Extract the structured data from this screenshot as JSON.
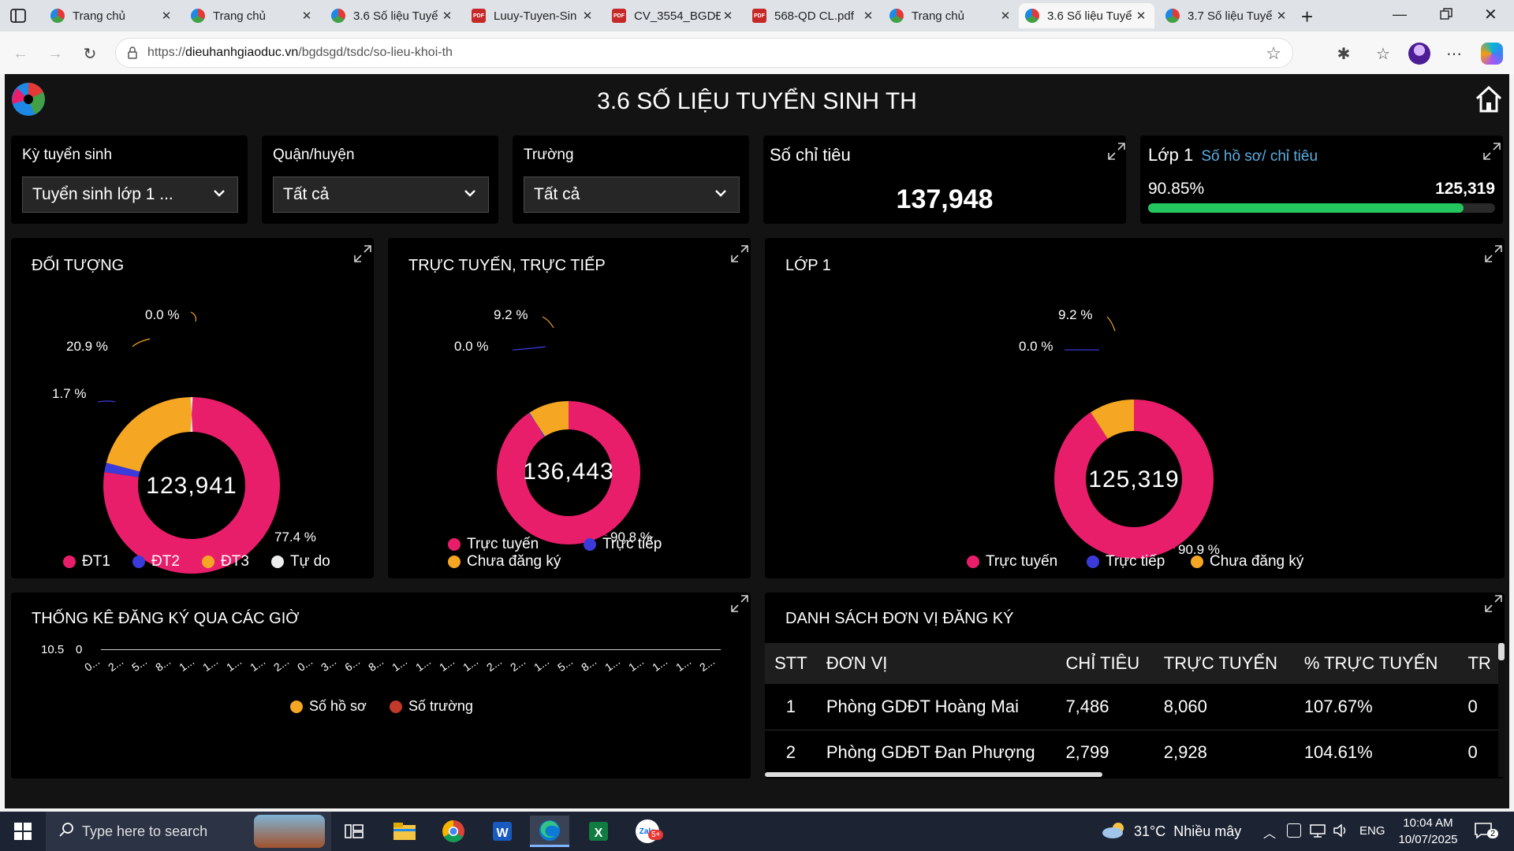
{
  "browser": {
    "tabs": [
      {
        "label": "Trang chủ",
        "icon": "site-favicon"
      },
      {
        "label": "Trang chủ",
        "icon": "site-favicon"
      },
      {
        "label": "3.6 Số liệu Tuyể",
        "icon": "site-favicon"
      },
      {
        "label": "Luuy-Tuyen-Sin",
        "icon": "pdf-icon"
      },
      {
        "label": "CV_3554_BGDĐ",
        "icon": "pdf-icon"
      },
      {
        "label": "568-QD CL.pdf",
        "icon": "pdf-icon"
      },
      {
        "label": "Trang chủ",
        "icon": "site-favicon"
      },
      {
        "label": "3.6 Số liệu Tuyể",
        "icon": "site-favicon",
        "active": true
      },
      {
        "label": "3.7 Số liệu Tuyể",
        "icon": "site-favicon"
      }
    ],
    "url_prefix": "https://",
    "url_host": "dieuhanhgiaoduc.vn",
    "url_path": "/bgdsgd/tsdc/so-lieu-khoi-th",
    "pdf_badge": "PDF"
  },
  "dashboard": {
    "title": "3.6 SỐ LIỆU TUYỂN SINH TH",
    "filters": {
      "ky_label": "Kỳ tuyển sinh",
      "ky_value": "Tuyển sinh lớp 1 ...",
      "quan_label": "Quận/huyện",
      "quan_value": "Tất cả",
      "truong_label": "Trường",
      "truong_value": "Tất cả"
    },
    "chi_tieu": {
      "label": "Số chỉ tiêu",
      "value": "137,948"
    },
    "lop1_card": {
      "label": "Lớp 1",
      "sublabel": "Số hồ sơ/ chỉ tiêu",
      "percent": "90.85%",
      "value": "125,319",
      "progress": 0.9085
    },
    "doi_tuong": {
      "title": "ĐỐI TƯỢNG",
      "center": "123,941",
      "labels": [
        "77.4 %",
        "1.7 %",
        "20.9 %",
        "0.0 %"
      ],
      "legend": [
        "ĐT1",
        "ĐT2",
        "ĐT3",
        "Tự do"
      ]
    },
    "truc_tuyen": {
      "title": "TRỰC TUYẾN, TRỰC TIẾP",
      "center": "136,443",
      "labels": [
        "90.8 %",
        "0.0 %",
        "9.2 %"
      ],
      "legend": [
        "Trực tuyến",
        "Trực tiếp",
        "Chưa đăng ký"
      ]
    },
    "lop1": {
      "title": "LỚP 1",
      "center": "125,319",
      "labels": [
        "90.9 %",
        "0.0 %",
        "9.2 %"
      ],
      "legend": [
        "Trực tuyến",
        "Trực tiếp",
        "Chưa đăng ký"
      ]
    },
    "thong_ke": {
      "title": "THỐNG KÊ ĐĂNG KÝ QUA CÁC GIỜ",
      "ytick": "10.5",
      "ytick_overlap": "0",
      "xticks": [
        "0...",
        "2...",
        "5...",
        "8...",
        "1...",
        "1...",
        "1...",
        "1...",
        "2...",
        "0...",
        "3...",
        "6...",
        "8...",
        "1...",
        "1...",
        "1...",
        "1...",
        "2...",
        "2...",
        "1...",
        "5...",
        "8...",
        "1...",
        "1...",
        "1...",
        "1...",
        "2..."
      ],
      "legend": [
        "Số hồ sơ",
        "Số trường"
      ]
    },
    "danh_sach": {
      "title": "DANH SÁCH ĐƠN VỊ ĐĂNG KÝ",
      "headers": [
        "STT",
        "ĐƠN VỊ",
        "CHỈ TIÊU",
        "TRỰC TUYẾN",
        "% TRỰC TUYẾN",
        "TR"
      ],
      "rows": [
        [
          "1",
          "Phòng GDĐT Hoàng Mai",
          "7,486",
          "8,060",
          "107.67%",
          "0"
        ],
        [
          "2",
          "Phòng GDĐT Đan Phượng",
          "2,799",
          "2,928",
          "104.61%",
          "0"
        ]
      ]
    }
  },
  "chart_data": [
    {
      "type": "pie",
      "title": "ĐỐI TƯỢNG",
      "categories": [
        "ĐT1",
        "ĐT2",
        "ĐT3",
        "Tự do"
      ],
      "values": [
        77.4,
        1.7,
        20.9,
        0.0
      ],
      "center_total": 123941,
      "colors": [
        "#e91e6b",
        "#3b3bdb",
        "#f5a623",
        "#eeeeee"
      ]
    },
    {
      "type": "pie",
      "title": "TRỰC TUYẾN, TRỰC TIẾP",
      "categories": [
        "Trực tuyến",
        "Trực tiếp",
        "Chưa đăng ký"
      ],
      "values": [
        90.8,
        0.0,
        9.2
      ],
      "center_total": 136443,
      "colors": [
        "#e91e6b",
        "#3b3bdb",
        "#f5a623"
      ]
    },
    {
      "type": "pie",
      "title": "LỚP 1",
      "categories": [
        "Trực tuyến",
        "Trực tiếp",
        "Chưa đăng ký"
      ],
      "values": [
        90.9,
        0.0,
        9.2
      ],
      "center_total": 125319,
      "colors": [
        "#e91e6b",
        "#3b3bdb",
        "#f5a623"
      ]
    },
    {
      "type": "line",
      "title": "THỐNG KÊ ĐĂNG KÝ QUA CÁC GIỜ",
      "series": [
        {
          "name": "Số hồ sơ",
          "color": "#f5a623"
        },
        {
          "name": "Số trường",
          "color": "#c0392b"
        }
      ]
    }
  ],
  "taskbar": {
    "search_placeholder": "Type here to search",
    "weather": "31°C  Nhiều mây",
    "lang": "ENG",
    "time": "10:04 AM",
    "date": "10/07/2025",
    "notif_count": "2",
    "zalo_badge": "5+",
    "zalo_label": "Zalo"
  },
  "colors": {
    "pink": "#e91e6b",
    "blue": "#3b3bdb",
    "orange": "#f5a623",
    "green": "#22c55e"
  }
}
